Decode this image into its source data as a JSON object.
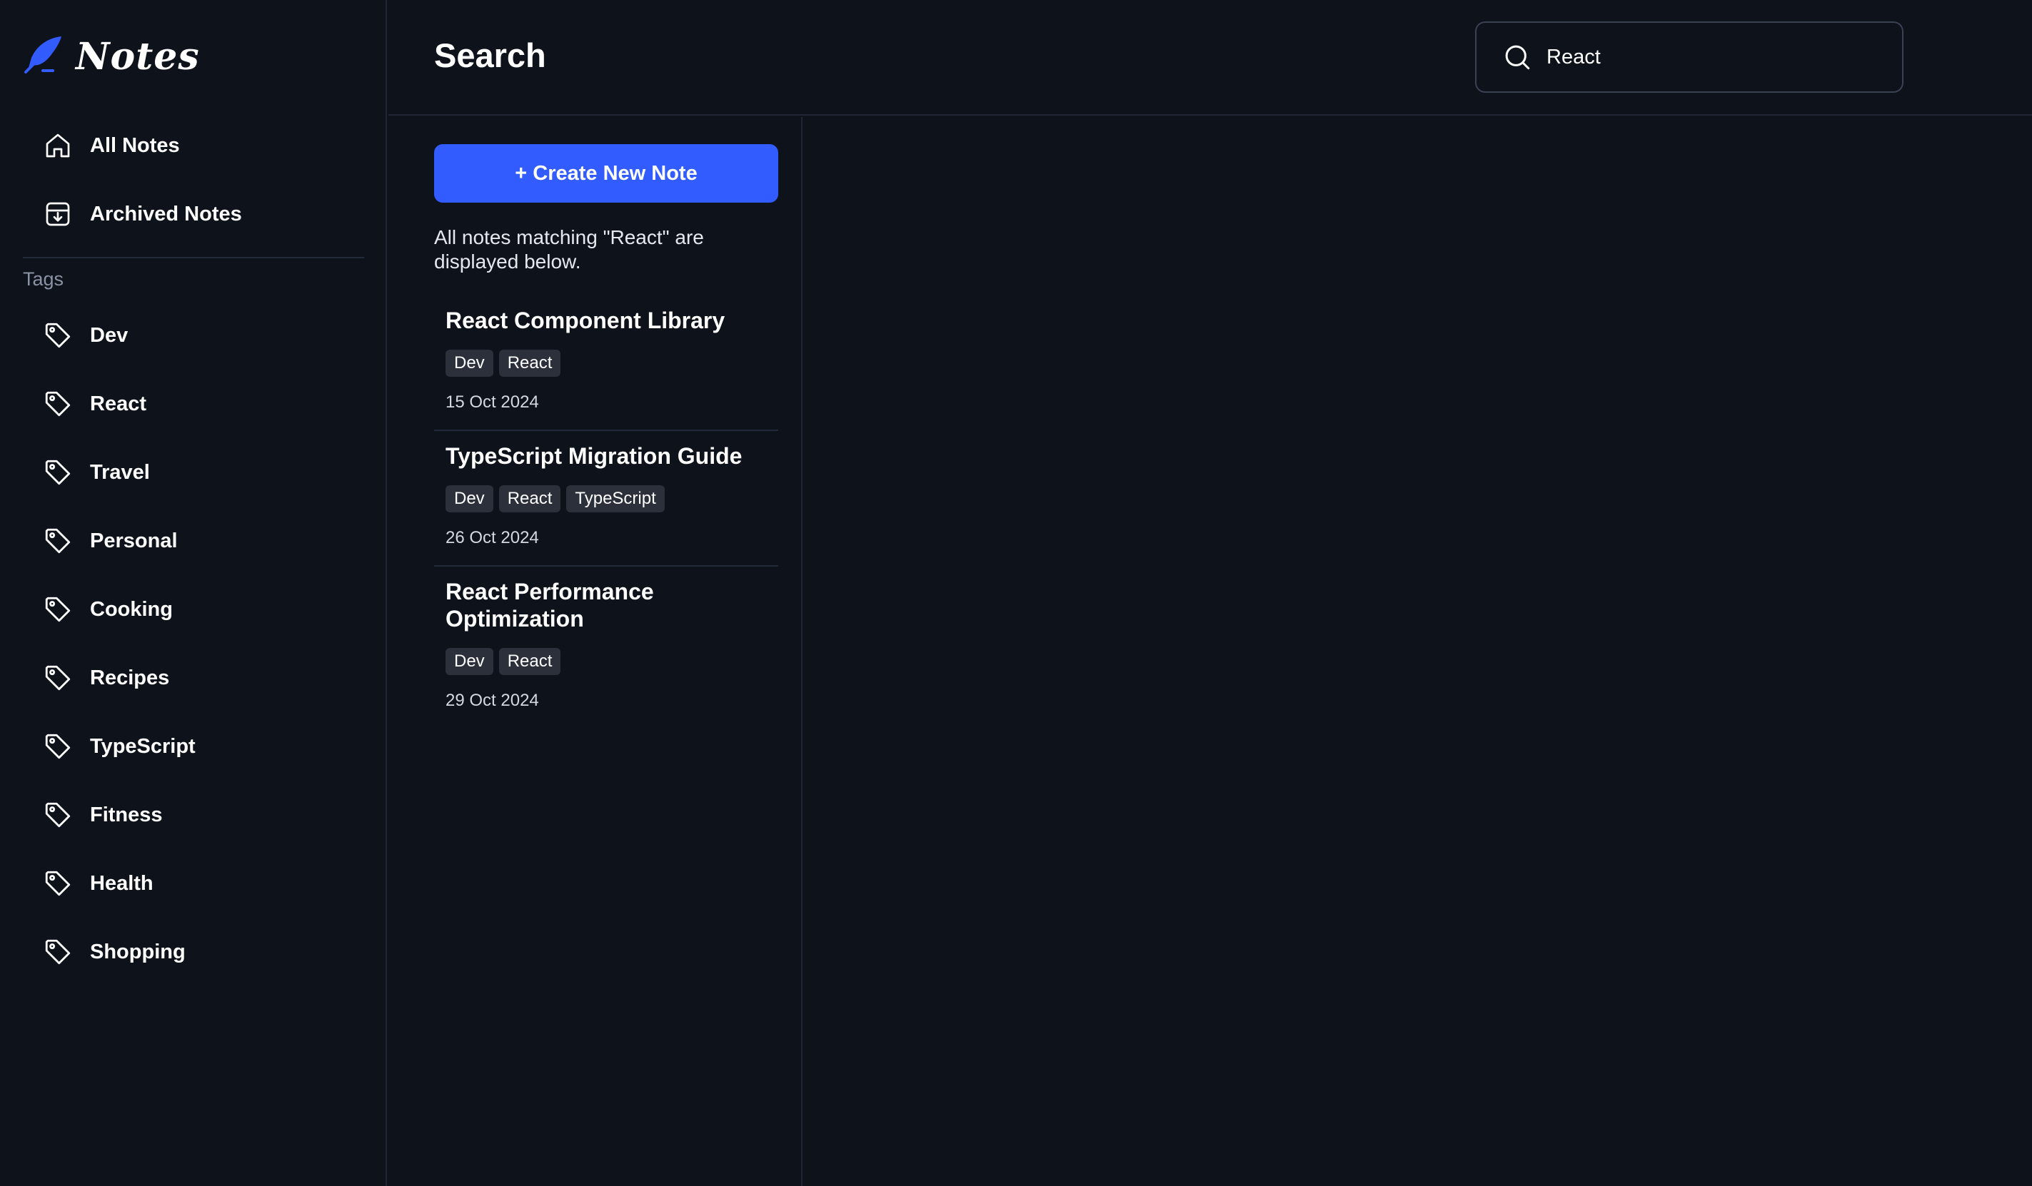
{
  "app": {
    "name": "Notes"
  },
  "sidebar": {
    "nav": [
      {
        "label": "All Notes",
        "icon": "home-icon"
      },
      {
        "label": "Archived Notes",
        "icon": "archive-icon"
      }
    ],
    "tags_heading": "Tags",
    "tags": [
      {
        "label": "Dev",
        "icon": "tag-icon"
      },
      {
        "label": "React",
        "icon": "tag-icon"
      },
      {
        "label": "Travel",
        "icon": "tag-icon"
      },
      {
        "label": "Personal",
        "icon": "tag-icon"
      },
      {
        "label": "Cooking",
        "icon": "tag-icon"
      },
      {
        "label": "Recipes",
        "icon": "tag-icon"
      },
      {
        "label": "TypeScript",
        "icon": "tag-icon"
      },
      {
        "label": "Fitness",
        "icon": "tag-icon"
      },
      {
        "label": "Health",
        "icon": "tag-icon"
      },
      {
        "label": "Shopping",
        "icon": "tag-icon"
      }
    ]
  },
  "header": {
    "title": "Search",
    "search": {
      "value": "React",
      "icon": "search-icon"
    }
  },
  "notes_panel": {
    "create_label": "+ Create New Note",
    "match_text": "All notes matching \"React\" are displayed below.",
    "notes": [
      {
        "title": "React Component Library",
        "tags": [
          "Dev",
          "React"
        ],
        "date": "15 Oct 2024"
      },
      {
        "title": "TypeScript Migration Guide",
        "tags": [
          "Dev",
          "React",
          "TypeScript"
        ],
        "date": "26 Oct 2024"
      },
      {
        "title": "React Performance Optimization",
        "tags": [
          "Dev",
          "React"
        ],
        "date": "29 Oct 2024"
      }
    ]
  },
  "colors": {
    "background": "#0e121b",
    "accent": "#335cff",
    "tag_chip": "#2b303b",
    "divider": "#1f2533",
    "muted_text": "#8a92a3"
  }
}
